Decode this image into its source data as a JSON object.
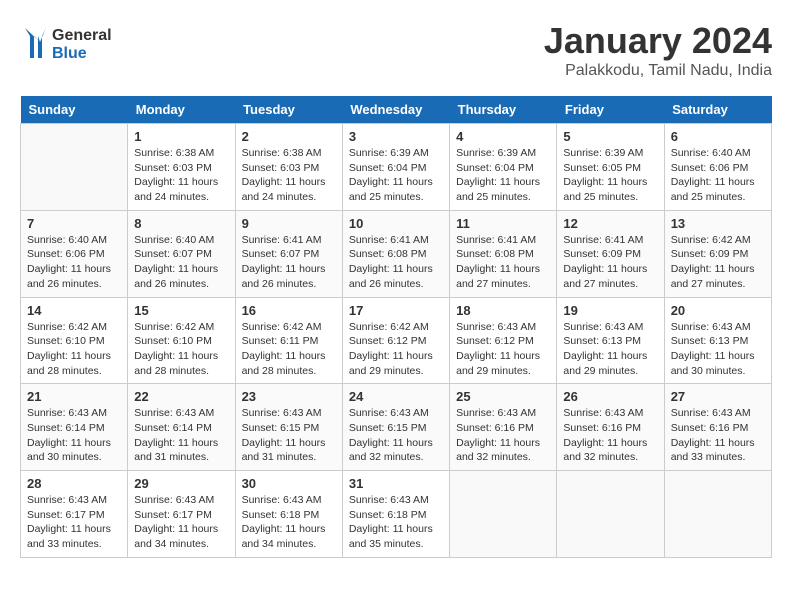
{
  "header": {
    "logo_general": "General",
    "logo_blue": "Blue",
    "title": "January 2024",
    "subtitle": "Palakkodu, Tamil Nadu, India"
  },
  "days": [
    "Sunday",
    "Monday",
    "Tuesday",
    "Wednesday",
    "Thursday",
    "Friday",
    "Saturday"
  ],
  "weeks": [
    [
      {
        "date": "",
        "info": ""
      },
      {
        "date": "1",
        "info": "Sunrise: 6:38 AM\nSunset: 6:03 PM\nDaylight: 11 hours\nand 24 minutes."
      },
      {
        "date": "2",
        "info": "Sunrise: 6:38 AM\nSunset: 6:03 PM\nDaylight: 11 hours\nand 24 minutes."
      },
      {
        "date": "3",
        "info": "Sunrise: 6:39 AM\nSunset: 6:04 PM\nDaylight: 11 hours\nand 25 minutes."
      },
      {
        "date": "4",
        "info": "Sunrise: 6:39 AM\nSunset: 6:04 PM\nDaylight: 11 hours\nand 25 minutes."
      },
      {
        "date": "5",
        "info": "Sunrise: 6:39 AM\nSunset: 6:05 PM\nDaylight: 11 hours\nand 25 minutes."
      },
      {
        "date": "6",
        "info": "Sunrise: 6:40 AM\nSunset: 6:06 PM\nDaylight: 11 hours\nand 25 minutes."
      }
    ],
    [
      {
        "date": "7",
        "info": "Sunrise: 6:40 AM\nSunset: 6:06 PM\nDaylight: 11 hours\nand 26 minutes."
      },
      {
        "date": "8",
        "info": "Sunrise: 6:40 AM\nSunset: 6:07 PM\nDaylight: 11 hours\nand 26 minutes."
      },
      {
        "date": "9",
        "info": "Sunrise: 6:41 AM\nSunset: 6:07 PM\nDaylight: 11 hours\nand 26 minutes."
      },
      {
        "date": "10",
        "info": "Sunrise: 6:41 AM\nSunset: 6:08 PM\nDaylight: 11 hours\nand 26 minutes."
      },
      {
        "date": "11",
        "info": "Sunrise: 6:41 AM\nSunset: 6:08 PM\nDaylight: 11 hours\nand 27 minutes."
      },
      {
        "date": "12",
        "info": "Sunrise: 6:41 AM\nSunset: 6:09 PM\nDaylight: 11 hours\nand 27 minutes."
      },
      {
        "date": "13",
        "info": "Sunrise: 6:42 AM\nSunset: 6:09 PM\nDaylight: 11 hours\nand 27 minutes."
      }
    ],
    [
      {
        "date": "14",
        "info": "Sunrise: 6:42 AM\nSunset: 6:10 PM\nDaylight: 11 hours\nand 28 minutes."
      },
      {
        "date": "15",
        "info": "Sunrise: 6:42 AM\nSunset: 6:10 PM\nDaylight: 11 hours\nand 28 minutes."
      },
      {
        "date": "16",
        "info": "Sunrise: 6:42 AM\nSunset: 6:11 PM\nDaylight: 11 hours\nand 28 minutes."
      },
      {
        "date": "17",
        "info": "Sunrise: 6:42 AM\nSunset: 6:12 PM\nDaylight: 11 hours\nand 29 minutes."
      },
      {
        "date": "18",
        "info": "Sunrise: 6:43 AM\nSunset: 6:12 PM\nDaylight: 11 hours\nand 29 minutes."
      },
      {
        "date": "19",
        "info": "Sunrise: 6:43 AM\nSunset: 6:13 PM\nDaylight: 11 hours\nand 29 minutes."
      },
      {
        "date": "20",
        "info": "Sunrise: 6:43 AM\nSunset: 6:13 PM\nDaylight: 11 hours\nand 30 minutes."
      }
    ],
    [
      {
        "date": "21",
        "info": "Sunrise: 6:43 AM\nSunset: 6:14 PM\nDaylight: 11 hours\nand 30 minutes."
      },
      {
        "date": "22",
        "info": "Sunrise: 6:43 AM\nSunset: 6:14 PM\nDaylight: 11 hours\nand 31 minutes."
      },
      {
        "date": "23",
        "info": "Sunrise: 6:43 AM\nSunset: 6:15 PM\nDaylight: 11 hours\nand 31 minutes."
      },
      {
        "date": "24",
        "info": "Sunrise: 6:43 AM\nSunset: 6:15 PM\nDaylight: 11 hours\nand 32 minutes."
      },
      {
        "date": "25",
        "info": "Sunrise: 6:43 AM\nSunset: 6:16 PM\nDaylight: 11 hours\nand 32 minutes."
      },
      {
        "date": "26",
        "info": "Sunrise: 6:43 AM\nSunset: 6:16 PM\nDaylight: 11 hours\nand 32 minutes."
      },
      {
        "date": "27",
        "info": "Sunrise: 6:43 AM\nSunset: 6:16 PM\nDaylight: 11 hours\nand 33 minutes."
      }
    ],
    [
      {
        "date": "28",
        "info": "Sunrise: 6:43 AM\nSunset: 6:17 PM\nDaylight: 11 hours\nand 33 minutes."
      },
      {
        "date": "29",
        "info": "Sunrise: 6:43 AM\nSunset: 6:17 PM\nDaylight: 11 hours\nand 34 minutes."
      },
      {
        "date": "30",
        "info": "Sunrise: 6:43 AM\nSunset: 6:18 PM\nDaylight: 11 hours\nand 34 minutes."
      },
      {
        "date": "31",
        "info": "Sunrise: 6:43 AM\nSunset: 6:18 PM\nDaylight: 11 hours\nand 35 minutes."
      },
      {
        "date": "",
        "info": ""
      },
      {
        "date": "",
        "info": ""
      },
      {
        "date": "",
        "info": ""
      }
    ]
  ]
}
